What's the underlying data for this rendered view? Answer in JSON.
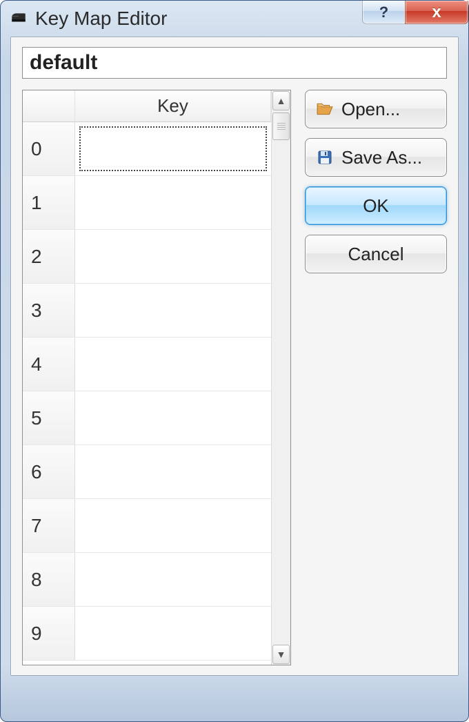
{
  "window": {
    "title": "Key Map Editor"
  },
  "name_field": {
    "value": "default"
  },
  "table": {
    "header": {
      "rowcol": "",
      "keycol": "Key"
    },
    "rows": [
      {
        "index": "0",
        "key": ""
      },
      {
        "index": "1",
        "key": ""
      },
      {
        "index": "2",
        "key": ""
      },
      {
        "index": "3",
        "key": ""
      },
      {
        "index": "4",
        "key": ""
      },
      {
        "index": "5",
        "key": ""
      },
      {
        "index": "6",
        "key": ""
      },
      {
        "index": "7",
        "key": ""
      },
      {
        "index": "8",
        "key": ""
      },
      {
        "index": "9",
        "key": ""
      }
    ]
  },
  "buttons": {
    "open": "Open...",
    "save_as": "Save As...",
    "ok": "OK",
    "cancel": "Cancel"
  }
}
